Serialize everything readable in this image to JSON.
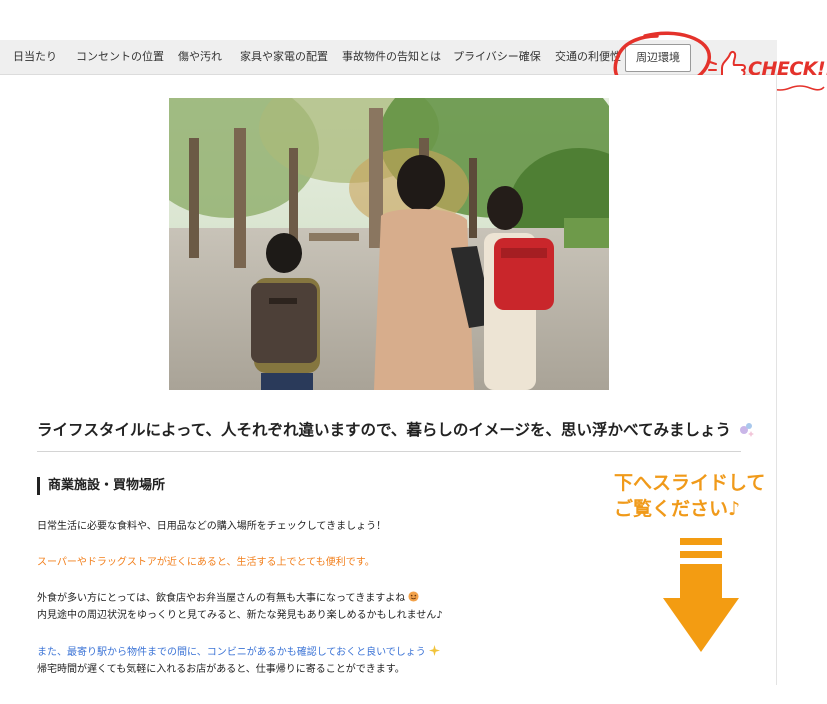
{
  "tabs": [
    {
      "label": "日当たり"
    },
    {
      "label": "コンセントの位置"
    },
    {
      "label": "傷や汚れ"
    },
    {
      "label": "家具や家電の配置"
    },
    {
      "label": "事故物件の告知とは"
    },
    {
      "label": "プライバシー確保"
    },
    {
      "label": "交通の利便性"
    },
    {
      "label": "周辺環境"
    }
  ],
  "active_tab": "周辺環境",
  "check_label": "CHECK!!",
  "lead": "ライフスタイルによって、人それぞれ違いますので、暮らしのイメージを、思い浮かべてみましょう",
  "section": {
    "heading": "商業施設・買物場所",
    "p1": "日常生活に必要な食料や、日用品などの購入場所をチェックしてきましょう！",
    "p2_highlight": "スーパーやドラッグストアが近くにあると、生活する上でとても便利です。",
    "p3_line1": "外食が多い方にとっては、飲食店やお弁当屋さんの有無も大事になってきますよね",
    "p3_line2": "内見途中の周辺状況をゆっくりと見てみると、新たな発見もあり楽しめるかもしれません♪",
    "p4_highlight": "また、最寄り駅から物件までの間に、コンビニがあるかも確認しておくと良いでしょう",
    "p4_line2": "帰宅時間が遅くても気軽に入れるお店があると、仕事帰りに寄ることができます。"
  },
  "slide_note": {
    "line1": "下へスライドして",
    "line2": "ご覧ください♪"
  },
  "colors": {
    "accent_orange": "#f2801e",
    "link_blue": "#3c74d6",
    "check_red": "#e4322b",
    "arrow_orange": "#f39c12"
  },
  "icons": [
    "sparkle-icon",
    "smiley-icon",
    "thumbs-up-icon",
    "down-arrow-icon"
  ]
}
